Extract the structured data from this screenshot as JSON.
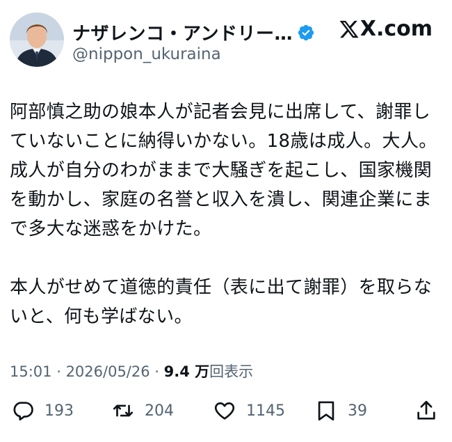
{
  "tweet": {
    "display_name": "ナザレンコ・アンドリー…",
    "handle": "@nippon_ukuraina",
    "site": "X.com",
    "text": "阿部慎之助の娘本人が記者会見に出席して、謝罪していないことに納得いかない。18歳は成人。大人。成人が自分のわがままで大騒ぎを起こし、国家機関を動かし、家庭の名誉と収入を潰し、関連企業にまで多大な迷惑をかけた。\n\n本人がせめて道徳的責任（表に出て謝罪）を取らないと、何も学ばない。",
    "time": "15:01",
    "date": "2026/05/26",
    "sep": " · ",
    "views_value": "9.4 万",
    "views_label": "回表示"
  },
  "actions": {
    "replies": "193",
    "retweets": "204",
    "likes": "1145",
    "bookmarks": "39"
  },
  "colors": {
    "verified": "#1d9bf0",
    "text": "#0f1419",
    "muted": "#536471"
  }
}
